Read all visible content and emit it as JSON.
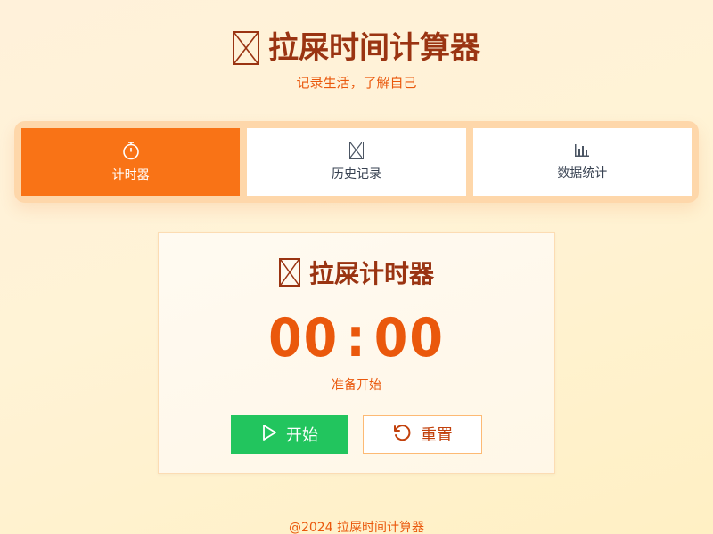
{
  "header": {
    "title_icon": "missing-glyph-box",
    "title": "拉屎时间计算器",
    "subtitle": "记录生活，了解自己"
  },
  "tabs": [
    {
      "icon": "stopwatch-icon",
      "label": "计时器",
      "active": true
    },
    {
      "icon": "missing-glyph-box",
      "label": "历史记录",
      "active": false
    },
    {
      "icon": "bar-chart-icon",
      "label": "数据统计",
      "active": false
    }
  ],
  "timer_card": {
    "title_icon": "missing-glyph-box",
    "title": "拉屎计时器",
    "minutes": "00",
    "colon": ":",
    "seconds": "00",
    "status": "准备开始",
    "start_label": "开始",
    "reset_label": "重置"
  },
  "footer": {
    "text": "@2024 拉屎时间计算器"
  },
  "colors": {
    "accent": "#f97316",
    "accent_dark": "#9a3412",
    "timer": "#ea580c",
    "start_button": "#22c55e",
    "tab_bar": "#fed7aa"
  }
}
